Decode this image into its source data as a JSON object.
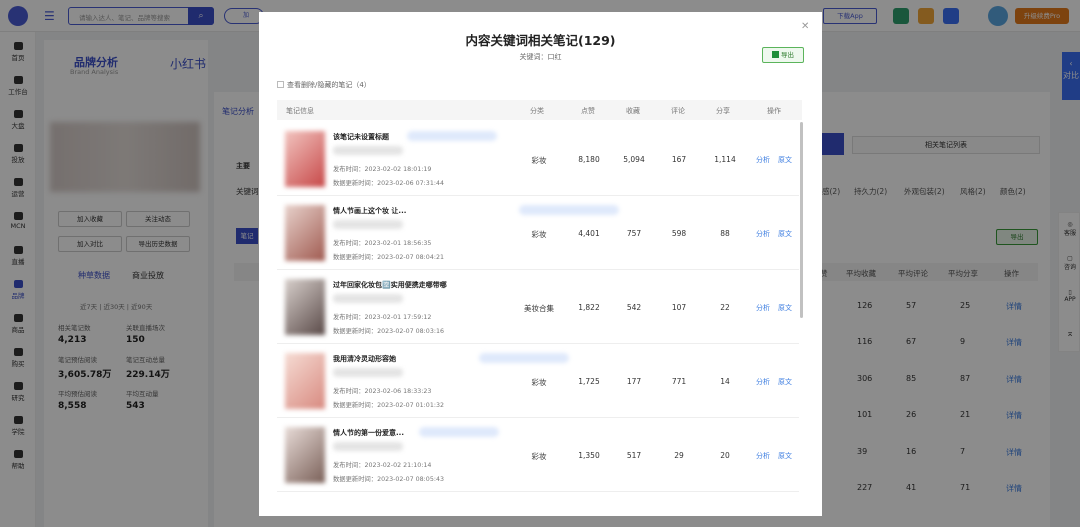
{
  "topbar": {
    "search_placeholder": "请输入达人、笔记、品牌等搜索",
    "pill_label": "加",
    "app_download": "下载App",
    "upgrade": "升级续费Pro"
  },
  "sidebar": {
    "items": [
      {
        "label": "首页"
      },
      {
        "label": "工作台"
      },
      {
        "label": "大盘"
      },
      {
        "label": "投放"
      },
      {
        "label": "运营"
      },
      {
        "label": "MCN"
      },
      {
        "label": "直播"
      },
      {
        "label": "品牌"
      },
      {
        "label": "商品"
      },
      {
        "label": "购买"
      },
      {
        "label": "研究"
      },
      {
        "label": "学院"
      },
      {
        "label": "帮助"
      }
    ]
  },
  "brand": {
    "title": "品牌分析",
    "subtitle": "Brand Analysis",
    "platform": "小红书",
    "buttons": [
      "加入收藏",
      "关注动态",
      "加入对比",
      "导出历史数据"
    ],
    "tabs": [
      "种草数据",
      "商业投放"
    ],
    "periods": "近7天 | 近30天 | 近90天",
    "stats": [
      {
        "label": "相关笔记数",
        "value": "4,213"
      },
      {
        "label": "关联直播场次",
        "value": "150"
      },
      {
        "label": "笔记预估阅读",
        "value": "3,605.78万"
      },
      {
        "label": "笔记互动总量",
        "value": "229.14万"
      },
      {
        "label": "平均预估阅读",
        "value": "8,558"
      },
      {
        "label": "平均互动量",
        "value": "543"
      }
    ]
  },
  "background": {
    "section_tab": "笔记分析",
    "main_label": "主要",
    "keyword_label": "关键词",
    "notes_btn": "笔记",
    "related_list": "相关笔记列表",
    "filters": [
      "感(2)",
      "持久力(2)",
      "外观包装(2)",
      "风格(2)",
      "颜色(2)"
    ],
    "export": "导出",
    "headers": [
      "赞",
      "平均收藏",
      "平均评论",
      "平均分享",
      "操作"
    ],
    "rows": [
      [
        "126",
        "57",
        "25",
        "详情"
      ],
      [
        "116",
        "67",
        "9",
        "详情"
      ],
      [
        "306",
        "85",
        "87",
        "详情"
      ],
      [
        "101",
        "26",
        "21",
        "详情"
      ],
      [
        "39",
        "16",
        "7",
        "详情"
      ],
      [
        "227",
        "41",
        "71",
        "详情"
      ]
    ]
  },
  "compare_tab": "对比",
  "right_tools": [
    "客服",
    "咨询",
    "APP"
  ],
  "modal": {
    "title": "内容关键词相关笔记(129)",
    "keyword_line": "关键词：口红",
    "export": "导出",
    "show_deleted": "查看删除/隐藏的笔记（4）",
    "columns": [
      "笔记信息",
      "分类",
      "点赞",
      "收藏",
      "评论",
      "分享",
      "操作"
    ],
    "action_analyze": "分析",
    "action_original": "原文",
    "rows": [
      {
        "title": "该笔记未设置标题",
        "published": "发布时间：2023-02-02 18:01:19",
        "updated": "数据更新时间：2023-02-06 07:31:44",
        "category": "彩妆",
        "likes": "8,180",
        "favs": "5,094",
        "comments": "167",
        "shares": "1,114"
      },
      {
        "title": "情人节画上这个妆 让...",
        "published": "发布时间：2023-02-01 18:56:35",
        "updated": "数据更新时间：2023-02-07 08:04:21",
        "category": "彩妆",
        "likes": "4,401",
        "favs": "757",
        "comments": "598",
        "shares": "88"
      },
      {
        "title": "过年回家化妆包🈳实用便携走哪带哪",
        "published": "发布时间：2023-02-01 17:59:12",
        "updated": "数据更新时间：2023-02-07 08:03:16",
        "category": "美妆合集",
        "likes": "1,822",
        "favs": "542",
        "comments": "107",
        "shares": "22"
      },
      {
        "title": "我用清冷灵动形容她",
        "published": "发布时间：2023-02-06 18:33:23",
        "updated": "数据更新时间：2023-02-07 01:01:32",
        "category": "彩妆",
        "likes": "1,725",
        "favs": "177",
        "comments": "771",
        "shares": "14"
      },
      {
        "title": "情人节的第一份爱意...",
        "published": "发布时间：2023-02-02 21:10:14",
        "updated": "数据更新时间：2023-02-07 08:05:43",
        "category": "彩妆",
        "likes": "1,350",
        "favs": "517",
        "comments": "29",
        "shares": "20"
      }
    ]
  },
  "colors": {
    "accent": "#3b4fc9",
    "link": "#3b7ce0",
    "export_green": "#1f8f3a",
    "upgrade": "#e47a1c"
  }
}
